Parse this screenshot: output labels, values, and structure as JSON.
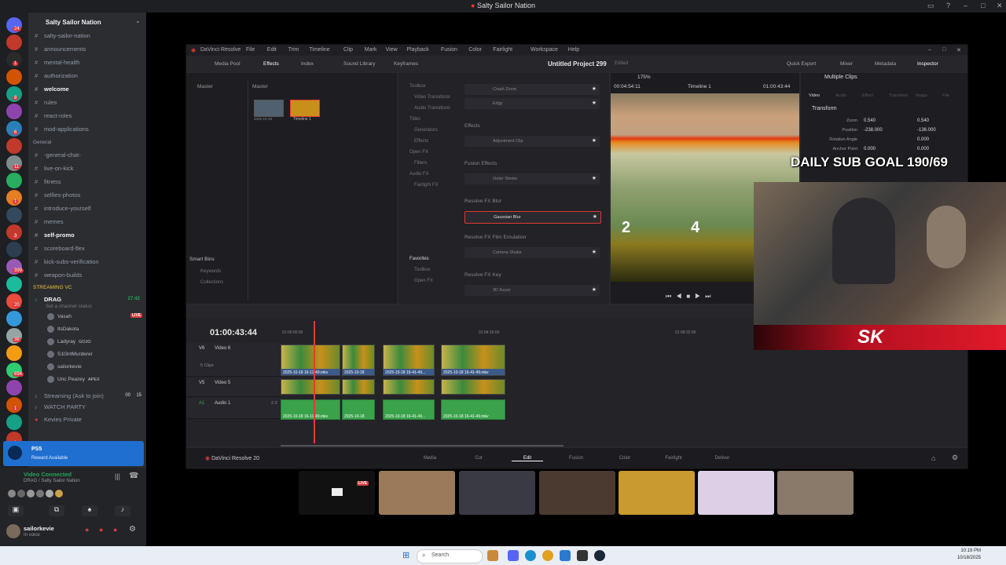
{
  "window": {
    "title": "Salty Sailor Nation"
  },
  "discord": {
    "server_name": "Salty Sailor Nation",
    "server_badges": [
      "24",
      "1",
      "8",
      "6",
      "11",
      "1",
      "3",
      "399",
      "20",
      "38",
      "694",
      "1",
      "1",
      "320",
      "NEW"
    ],
    "channels": [
      {
        "name": "salty-sailor-nation",
        "bold": false
      },
      {
        "name": "announcements",
        "bold": false
      },
      {
        "name": "mental-health",
        "bold": false
      },
      {
        "name": "authorization",
        "bold": false
      },
      {
        "name": "welcome",
        "bold": true
      },
      {
        "name": "rules",
        "bold": false
      },
      {
        "name": "react-roles",
        "bold": false
      },
      {
        "name": "mod-applications",
        "bold": false
      }
    ],
    "general_category": "General",
    "general_channels": [
      {
        "name": "-general-chat-",
        "bold": false
      },
      {
        "name": "live-on-kick",
        "bold": false
      },
      {
        "name": "fitness",
        "bold": false
      },
      {
        "name": "selfies-photos",
        "bold": false
      },
      {
        "name": "introduce-yourself",
        "bold": false
      },
      {
        "name": "memes",
        "bold": false
      },
      {
        "name": "self-promo",
        "bold": true
      },
      {
        "name": "scoreboard-flex",
        "bold": false
      },
      {
        "name": "kick-subs-verification",
        "bold": false
      },
      {
        "name": "weapon-builds",
        "bold": false
      }
    ],
    "streaming_category": "STREAMING VC",
    "voice_channel": {
      "name": "DRAG",
      "timer": "27:42",
      "status": "Set a channel status"
    },
    "voice_users": [
      {
        "name": "Vasah",
        "tag": "LIVE"
      },
      {
        "name": "ItsDakota",
        "tag": ""
      },
      {
        "name": "Ladyray",
        "tag": "GOJO"
      },
      {
        "name": "S1l3ntMurderer",
        "tag": ""
      },
      {
        "name": "sailorkevie",
        "tag": ""
      },
      {
        "name": "Unc Peazey",
        "tag": "APEX"
      }
    ],
    "streaming_channel": {
      "name": "Streaming (Ask to join)",
      "count_a": "00",
      "count_b": "15"
    },
    "watch_party": "WATCH PARTY",
    "kevies_private": "Kevies Private",
    "activity": {
      "title": "PS5",
      "subtitle": "Reward Available"
    },
    "voice_connected": {
      "title": "Video Connected",
      "subtitle": "DRAG / Salty Sailor Nation"
    },
    "user": {
      "name": "sailorkevie",
      "status": "In voice"
    }
  },
  "davinci": {
    "app": "DaVinci Resolve",
    "menu": [
      "File",
      "Edit",
      "Trim",
      "Timeline",
      "Clip",
      "Mark",
      "View",
      "Playback",
      "Fusion",
      "Color",
      "Fairlight",
      "Workspace",
      "Help"
    ],
    "toolbar_left": [
      "Media Pool",
      "Effects",
      "Index",
      "Sound Library",
      "Keyframes"
    ],
    "project_title": "Untitled Project 299",
    "project_status": "Edited",
    "toolbar_right": [
      "Quick Export",
      "Mixer",
      "Metadata",
      "Inspector"
    ],
    "media_pool": {
      "header_left": "Master",
      "header_right": "Master",
      "bins_title": "Smart Bins",
      "bins": [
        "Keywords",
        "Collections"
      ],
      "thumbs": [
        "2025-10-18",
        "Timeline 1"
      ]
    },
    "effects_tree": [
      "Toolbox",
      "Video Transitions",
      "Audio Transitions",
      "Titles",
      "Generators",
      "Effects",
      "Open FX",
      "Filters",
      "Audio FX",
      "Fairlight FX"
    ],
    "favorites_tree": [
      "Favorites",
      "Toolbox",
      "Open FX"
    ],
    "effects_list": {
      "top_items": [
        "Crash Zoom",
        "Edgy"
      ],
      "sections": [
        {
          "title": "Effects",
          "items": [
            "Adjustment Clip"
          ]
        },
        {
          "title": "Fusion Effects",
          "items": [
            "Outer Stroke"
          ]
        },
        {
          "title": "Resolve FX Blur",
          "items": [
            "Gaussian Blur"
          ]
        },
        {
          "title": "Resolve FX Film Emulation",
          "items": [
            "Camera Shake"
          ]
        },
        {
          "title": "Resolve FX Key",
          "items": [
            "3D Keyer"
          ]
        }
      ]
    },
    "viewer": {
      "zoom": "175%",
      "timecode_left": "00:04:54:11",
      "timeline_name": "Timeline 1",
      "timecode_right": "01:00:43:44",
      "score_left": "2",
      "score_right": "4"
    },
    "inspector": {
      "title": "Multiple Clips",
      "tabs": [
        "Video",
        "Audio",
        "Effect",
        "Transition",
        "Image",
        "File"
      ],
      "section": "Transform",
      "rows": [
        {
          "label": "Zoom",
          "x": "0.540",
          "y": "0.540"
        },
        {
          "label": "Position",
          "x": "-238.000",
          "y": "-136.000"
        },
        {
          "label": "Rotation Angle",
          "x": "",
          "y": "0.000"
        },
        {
          "label": "Anchor Point",
          "x": "0.000",
          "y": "0.000"
        }
      ]
    },
    "timeline": {
      "timecode": "01:00:43:44",
      "ruler": [
        "01:00:00:00",
        "01:04:16:00",
        "01:08:32:00"
      ],
      "tracks": [
        {
          "id": "V6",
          "name": "Video 6",
          "sub": "5 Clips"
        },
        {
          "id": "V5",
          "name": "Video 5",
          "sub": ""
        },
        {
          "id": "A1",
          "name": "Audio 1",
          "sub": "2.0"
        }
      ],
      "clip_labels": [
        "2025-10-18 16-11-49.mkv",
        "2025-10-18",
        "2025-10-18 16-41-49...",
        "2025-10-18 16-41-49.mkv"
      ]
    },
    "footer": {
      "brand": "DaVinci Resolve 20",
      "pages": [
        "Media",
        "Cut",
        "Edit",
        "Fusion",
        "Color",
        "Fairlight",
        "Deliver"
      ],
      "active_page": "Edit"
    }
  },
  "overlay": {
    "sub_goal": "DAILY SUB GOAL 190/69",
    "logo": "SK"
  },
  "cams": {
    "live_label": "LIVE"
  },
  "taskbar": {
    "search": "Search",
    "time": "10:19 PM",
    "date": "10/18/2025"
  },
  "colors": {
    "accent": "#5865f2",
    "discord_bg": "#2b2d31",
    "resolve_red": "#e53935",
    "live_red": "#da373c"
  }
}
